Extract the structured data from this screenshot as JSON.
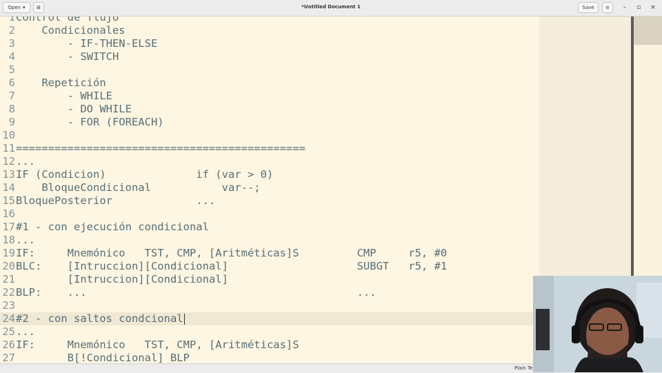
{
  "titlebar": {
    "open_label": "Open",
    "open_chevron": "▾",
    "new_tab_icon": "⊞",
    "title": "*Untitled Document 1",
    "save_label": "Save",
    "menu_icon": "≡",
    "minimize_icon": "–",
    "maximize_icon": "▫",
    "close_icon": "×"
  },
  "editor": {
    "lines": [
      {
        "n": "1",
        "text": "Control de flujo"
      },
      {
        "n": "2",
        "text": "    Condicionales"
      },
      {
        "n": "3",
        "text": "        - IF-THEN-ELSE"
      },
      {
        "n": "4",
        "text": "        - SWITCH"
      },
      {
        "n": "5",
        "text": ""
      },
      {
        "n": "6",
        "text": "    Repetición"
      },
      {
        "n": "7",
        "text": "        - WHILE"
      },
      {
        "n": "8",
        "text": "        - DO WHILE"
      },
      {
        "n": "9",
        "text": "        - FOR (FOREACH)"
      },
      {
        "n": "10",
        "text": ""
      },
      {
        "n": "11",
        "text": "============================================="
      },
      {
        "n": "12",
        "text": "..."
      },
      {
        "n": "13",
        "text": "IF (Condicion)              if (var > 0)"
      },
      {
        "n": "14",
        "text": "    BloqueCondicional           var--;"
      },
      {
        "n": "15",
        "text": "BloquePosterior             ..."
      },
      {
        "n": "16",
        "text": ""
      },
      {
        "n": "17",
        "text": "#1 - con ejecución condicional"
      },
      {
        "n": "18",
        "text": "..."
      },
      {
        "n": "19",
        "text": "IF:     Mnemónico   TST, CMP, [Aritméticas]S         CMP     r5, #0"
      },
      {
        "n": "20",
        "text": "BLC:    [Intruccion][Condicional]                    SUBGT   r5, #1"
      },
      {
        "n": "21",
        "text": "        [Intruccion][Condicional]"
      },
      {
        "n": "22",
        "text": "BLP:    ...                                          ..."
      },
      {
        "n": "23",
        "text": ""
      },
      {
        "n": "24",
        "text": "#2 - con saltos condcional"
      },
      {
        "n": "25",
        "text": "..."
      },
      {
        "n": "26",
        "text": "IF:     Mnemónico   TST, CMP, [Aritméticas]S"
      },
      {
        "n": "27",
        "text": "        B[!Condicional] BLP"
      }
    ],
    "current_line": "24"
  },
  "statusbar": {
    "language": "Plain Text"
  },
  "colors": {
    "background": "#fdf6e3",
    "current_line": "#eee8d5",
    "text": "#586e75",
    "line_numbers": "#839496"
  }
}
